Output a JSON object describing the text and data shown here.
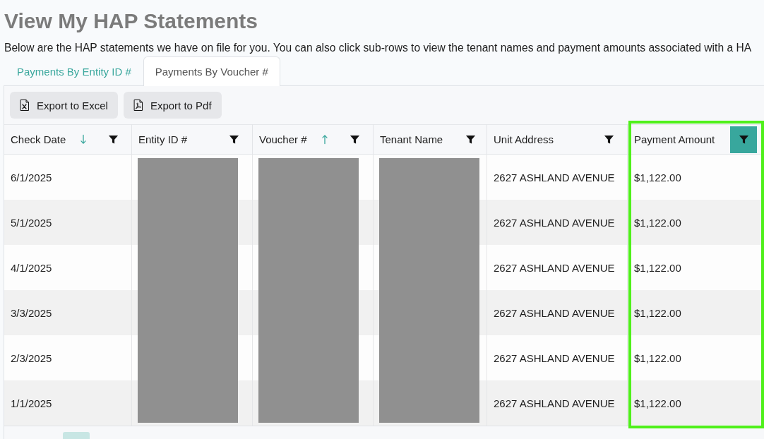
{
  "page": {
    "title": "View My HAP Statements",
    "intro": "Below are the HAP statements we have on file for you. You can also click sub-rows to view the tenant names and payment amounts associated with a HA"
  },
  "tabs": [
    {
      "label": "Payments By Entity ID #",
      "selected": false
    },
    {
      "label": "Payments By Voucher #",
      "selected": true
    }
  ],
  "toolbar": {
    "buttons": [
      {
        "kind": "excel",
        "label": "Export to Excel"
      },
      {
        "kind": "pdf",
        "label": "Export to Pdf"
      }
    ]
  },
  "table": {
    "columns": [
      {
        "label": "Check Date",
        "sort_ascending": false,
        "sort_descending": true,
        "filter_active": false,
        "redacted": false,
        "highlighted": false
      },
      {
        "label": "Entity ID #",
        "sort_ascending": false,
        "sort_descending": false,
        "filter_active": false,
        "redacted": true,
        "highlighted": false
      },
      {
        "label": "Voucher #",
        "sort_ascending": true,
        "sort_descending": false,
        "filter_active": false,
        "redacted": true,
        "highlighted": false
      },
      {
        "label": "Tenant Name",
        "sort_ascending": false,
        "sort_descending": false,
        "filter_active": false,
        "redacted": true,
        "highlighted": false
      },
      {
        "label": "Unit Address",
        "sort_ascending": false,
        "sort_descending": false,
        "filter_active": false,
        "redacted": false,
        "highlighted": false
      },
      {
        "label": "Payment Amount",
        "sort_ascending": false,
        "sort_descending": false,
        "filter_active": true,
        "redacted": false,
        "highlighted": true
      }
    ],
    "rows": [
      {
        "cells": [
          "6/1/2025",
          "2627 ASHLAND AVENUE",
          "$1,122.00"
        ]
      },
      {
        "cells": [
          "5/1/2025",
          "2627 ASHLAND AVENUE",
          "$1,122.00"
        ]
      },
      {
        "cells": [
          "4/1/2025",
          "2627 ASHLAND AVENUE",
          "$1,122.00"
        ]
      },
      {
        "cells": [
          "3/3/2025",
          "2627 ASHLAND AVENUE",
          "$1,122.00"
        ]
      },
      {
        "cells": [
          "2/3/2025",
          "2627 ASHLAND AVENUE",
          "$1,122.00"
        ]
      },
      {
        "cells": [
          "1/1/2025",
          "2627 ASHLAND AVENUE",
          "$1,122.00"
        ]
      }
    ]
  },
  "pager": {
    "pages": [
      {
        "selected": true
      }
    ]
  }
}
